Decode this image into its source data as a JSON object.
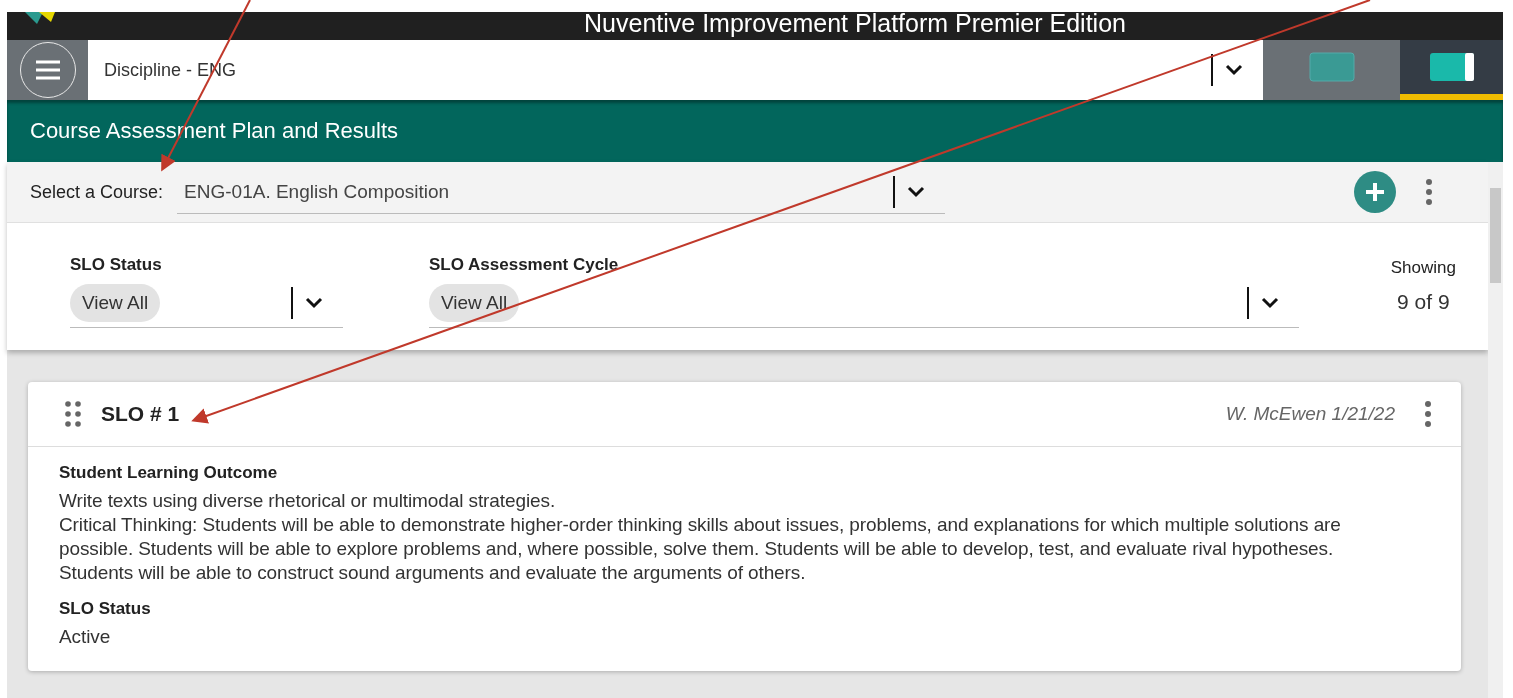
{
  "app_bar": {
    "title": "Nuventive Improvement Platform Premier Edition"
  },
  "toolbar": {
    "discipline": "Discipline - ENG",
    "view_toggles": [
      {
        "selected": false
      },
      {
        "selected": true
      }
    ]
  },
  "page_header": {
    "title": "Course Assessment Plan and Results"
  },
  "course_select": {
    "label": "Select a Course:",
    "value": "ENG-01A. English Composition"
  },
  "filters": [
    {
      "label": "SLO Status",
      "value": "View All"
    },
    {
      "label": "SLO Assessment Cycle",
      "value": "View All"
    }
  ],
  "showing": {
    "label": "Showing",
    "count": "9 of 9"
  },
  "slo_cards": [
    {
      "title": "SLO # 1",
      "author_date": "W. McEwen 1/21/22",
      "sections": [
        {
          "heading": "Student Learning Outcome",
          "paragraphs": [
            "Write texts using diverse rhetorical or multimodal strategies.",
            "Critical Thinking: Students will be able to demonstrate higher-order thinking skills about issues, problems, and explanations for which multiple solutions are possible. Students will be able to explore problems and, where possible, solve them. Students will be able to develop, test, and evaluate rival hypotheses. Students will be able to construct sound arguments and evaluate the arguments of others."
          ]
        },
        {
          "heading": "SLO Status",
          "paragraphs": [
            "Active"
          ]
        }
      ]
    }
  ]
}
